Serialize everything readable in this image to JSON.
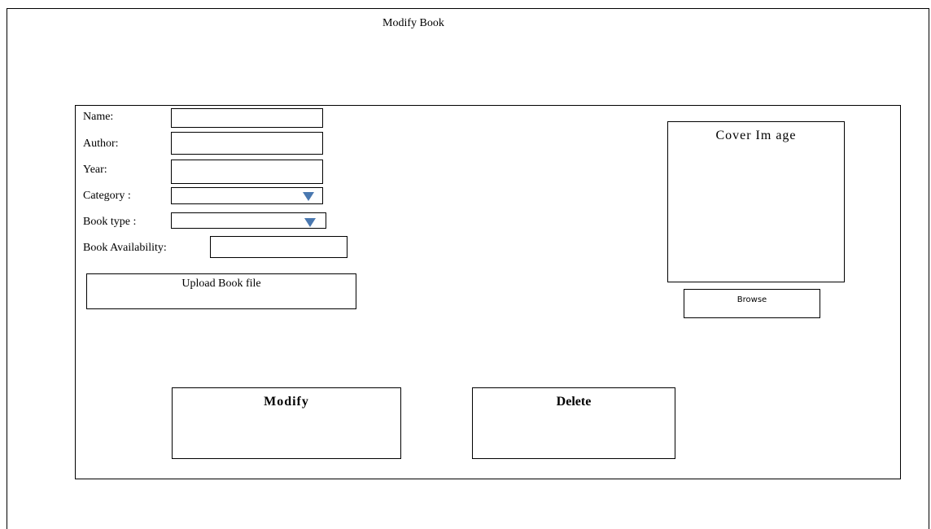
{
  "window": {
    "title": "Modify Book"
  },
  "form": {
    "name_label": "Name:",
    "author_label": "Author:",
    "year_label": "Year:",
    "category_label": "Category :",
    "book_type_label": "Book type :",
    "availability_label": "Book Availability:",
    "name_value": "",
    "author_value": "",
    "year_value": "",
    "category_value": "",
    "book_type_value": "",
    "availability_value": ""
  },
  "buttons": {
    "upload_label": "Upload Book file",
    "browse_label": "Browse",
    "modify_label": "Modify",
    "delete_label": "Delete"
  },
  "cover": {
    "label": "Cover Im age"
  },
  "icons": {
    "dropdown": "chevron-down-icon"
  },
  "colors": {
    "dropdown_arrow": "#4a78b0"
  }
}
